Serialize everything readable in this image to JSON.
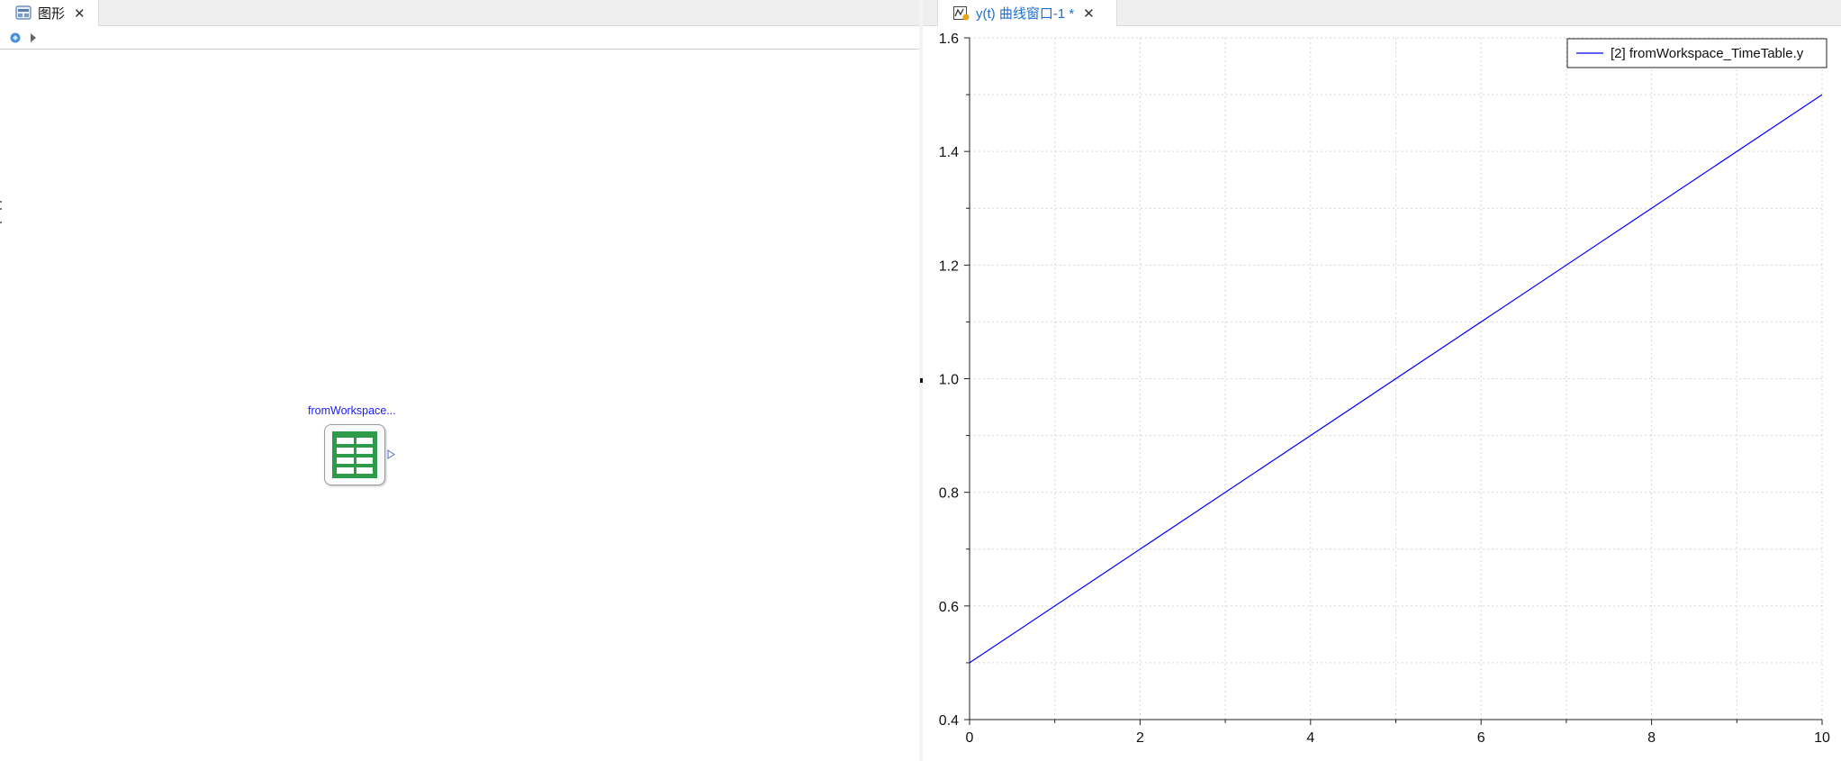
{
  "left_pane": {
    "tab": {
      "label": "图形",
      "close": "✕",
      "icon": "diagram-view-icon"
    },
    "toolbar": {
      "items": [
        "model-icon",
        "expand-arrow-icon"
      ]
    },
    "block": {
      "label": "fromWorkspace...",
      "icon": "table-icon",
      "icon_color": "#2e9b4a"
    }
  },
  "right_pane": {
    "tab": {
      "label": "y(t) 曲线窗口-1 *",
      "close": "✕",
      "icon": "plot-window-icon",
      "color": "#1a6fd6"
    }
  },
  "chart_data": {
    "type": "line",
    "title": "",
    "xlabel": "",
    "ylabel": "",
    "xlim": [
      0,
      10
    ],
    "ylim": [
      0.4,
      1.6
    ],
    "x_ticks": [
      "0",
      "2",
      "4",
      "6",
      "8",
      "10"
    ],
    "y_ticks": [
      "0.4",
      "0.6",
      "0.8",
      "1.0",
      "1.2",
      "1.4",
      "1.6"
    ],
    "grid": true,
    "legend_position": "top-right",
    "series": [
      {
        "name": "[2] fromWorkspace_TimeTable.y",
        "color": "#0000ff",
        "x": [
          0,
          10
        ],
        "y": [
          0.5,
          1.5
        ]
      }
    ]
  }
}
